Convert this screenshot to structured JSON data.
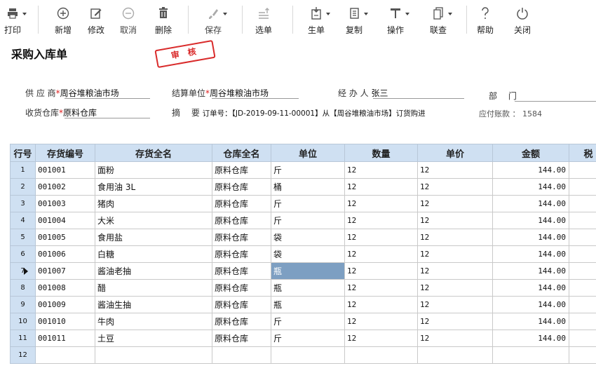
{
  "toolbar": {
    "print": "打印",
    "add": "新增",
    "edit": "修改",
    "cancel": "取消",
    "delete": "删除",
    "save": "保存",
    "select": "选单",
    "generate": "生单",
    "copy": "复制",
    "operate": "操作",
    "query": "联查",
    "help": "帮助",
    "close": "关闭"
  },
  "form": {
    "title": "采购入库单",
    "stamp": "审 核",
    "supplier_label": "供 应 商",
    "supplier_value": "周谷堆粮油市场",
    "settle_label": "结算单位",
    "settle_value": "周谷堆粮油市场",
    "handler_label": "经 办 人",
    "handler_value": "张三",
    "dept_label": "部　 门",
    "warehouse_label": "收货仓库",
    "warehouse_value": "原料仓库",
    "summary_label": "摘　 要",
    "summary_value": "订单号：【JD-2019-09-11-00001】从【周谷堆粮油市场】订货购进",
    "payable": "应付账款 ： 1584",
    "required_mark": "*"
  },
  "grid": {
    "headers": [
      "行号",
      "存货编号",
      "存货全名",
      "仓库全名",
      "单位",
      "数量",
      "单价",
      "金额",
      "税"
    ],
    "rows": [
      {
        "no": "1",
        "code": "001001",
        "name": "面粉",
        "wh": "原料仓库",
        "unit": "斤",
        "qty": "12",
        "price": "12",
        "amount": "144.00"
      },
      {
        "no": "2",
        "code": "001002",
        "name": "食用油 3L",
        "wh": "原料仓库",
        "unit": "桶",
        "qty": "12",
        "price": "12",
        "amount": "144.00"
      },
      {
        "no": "3",
        "code": "001003",
        "name": "猪肉",
        "wh": "原料仓库",
        "unit": "斤",
        "qty": "12",
        "price": "12",
        "amount": "144.00"
      },
      {
        "no": "4",
        "code": "001004",
        "name": "大米",
        "wh": "原料仓库",
        "unit": "斤",
        "qty": "12",
        "price": "12",
        "amount": "144.00"
      },
      {
        "no": "5",
        "code": "001005",
        "name": "食用盐",
        "wh": "原料仓库",
        "unit": "袋",
        "qty": "12",
        "price": "12",
        "amount": "144.00"
      },
      {
        "no": "6",
        "code": "001006",
        "name": "白糖",
        "wh": "原料仓库",
        "unit": "袋",
        "qty": "12",
        "price": "12",
        "amount": "144.00"
      },
      {
        "no": "7",
        "code": "001007",
        "name": "酱油老抽",
        "wh": "原料仓库",
        "unit": "瓶",
        "qty": "12",
        "price": "12",
        "amount": "144.00"
      },
      {
        "no": "8",
        "code": "001008",
        "name": "醋",
        "wh": "原料仓库",
        "unit": "瓶",
        "qty": "12",
        "price": "12",
        "amount": "144.00"
      },
      {
        "no": "9",
        "code": "001009",
        "name": "酱油生抽",
        "wh": "原料仓库",
        "unit": "瓶",
        "qty": "12",
        "price": "12",
        "amount": "144.00"
      },
      {
        "no": "10",
        "code": "001010",
        "name": "牛肉",
        "wh": "原料仓库",
        "unit": "斤",
        "qty": "12",
        "price": "12",
        "amount": "144.00"
      },
      {
        "no": "11",
        "code": "001011",
        "name": "土豆",
        "wh": "原料仓库",
        "unit": "斤",
        "qty": "12",
        "price": "12",
        "amount": "144.00"
      },
      {
        "no": "12",
        "code": "",
        "name": "",
        "wh": "",
        "unit": "",
        "qty": "",
        "price": "",
        "amount": ""
      }
    ]
  },
  "colors": {
    "header_bg": "#cfe0f2",
    "selected_cell": "#7d9fc2",
    "stamp_red": "#d92b2b",
    "required": "#e02020"
  }
}
